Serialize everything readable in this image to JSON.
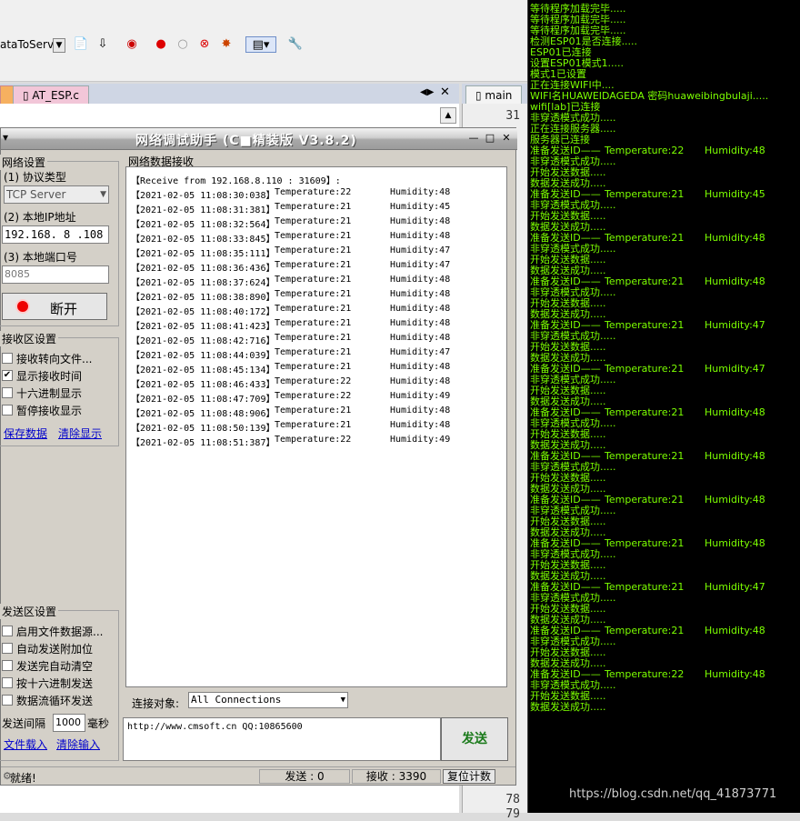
{
  "ide": {
    "toolbar_label": "ataToServer",
    "tabs": [
      {
        "label": "AT_ESP.c"
      }
    ],
    "right_tab": "main",
    "line_numbers": {
      "top": "31",
      "bottom_a": "78",
      "bottom_b": "79"
    }
  },
  "net": {
    "title": "网络调试助手 (C■精装版 V3.8.2)",
    "settings": {
      "group_title": "网络设置",
      "protocol_label": "(1) 协议类型",
      "protocol_value": "TCP Server",
      "ip_label": "(2) 本地IP地址",
      "ip_value": "192.168. 8 .108",
      "port_label": "(3) 本地端口号",
      "port_value": "8085",
      "disconnect_label": "断开"
    },
    "receive_settings": {
      "group_title": "接收区设置",
      "options": [
        {
          "label": "接收转向文件...",
          "checked": false
        },
        {
          "label": "显示接收时间",
          "checked": true
        },
        {
          "label": "十六进制显示",
          "checked": false
        },
        {
          "label": "暂停接收显示",
          "checked": false
        }
      ],
      "save_link": "保存数据",
      "clear_link": "清除显示"
    },
    "send_settings": {
      "group_title": "发送区设置",
      "options": [
        {
          "label": "启用文件数据源...",
          "checked": false
        },
        {
          "label": "自动发送附加位",
          "checked": false
        },
        {
          "label": "发送完自动清空",
          "checked": false
        },
        {
          "label": "按十六进制发送",
          "checked": false
        },
        {
          "label": "数据流循环发送",
          "checked": false
        }
      ],
      "interval_label": "发送间隔",
      "interval_value": "1000",
      "interval_unit": "毫秒",
      "file_link": "文件载入",
      "clear_input_link": "清除输入"
    },
    "data_group_title": "网络数据接收",
    "receive_header": "【Receive from 192.168.8.110 : 31609】:",
    "log": [
      {
        "time": "【2021-02-05 11:08:30:038】",
        "temp": "Temperature:22",
        "hum": "Humidity:48"
      },
      {
        "time": "【2021-02-05 11:08:31:381】",
        "temp": "Temperature:21",
        "hum": "Humidity:45"
      },
      {
        "time": "【2021-02-05 11:08:32:564】",
        "temp": "Temperature:21",
        "hum": "Humidity:48"
      },
      {
        "time": "【2021-02-05 11:08:33:845】",
        "temp": "Temperature:21",
        "hum": "Humidity:48"
      },
      {
        "time": "【2021-02-05 11:08:35:111】",
        "temp": "Temperature:21",
        "hum": "Humidity:47"
      },
      {
        "time": "【2021-02-05 11:08:36:436】",
        "temp": "Temperature:21",
        "hum": "Humidity:47"
      },
      {
        "time": "【2021-02-05 11:08:37:624】",
        "temp": "Temperature:21",
        "hum": "Humidity:48"
      },
      {
        "time": "【2021-02-05 11:08:38:890】",
        "temp": "Temperature:21",
        "hum": "Humidity:48"
      },
      {
        "time": "【2021-02-05 11:08:40:172】",
        "temp": "Temperature:21",
        "hum": "Humidity:48"
      },
      {
        "time": "【2021-02-05 11:08:41:423】",
        "temp": "Temperature:21",
        "hum": "Humidity:48"
      },
      {
        "time": "【2021-02-05 11:08:42:716】",
        "temp": "Temperature:21",
        "hum": "Humidity:48"
      },
      {
        "time": "【2021-02-05 11:08:44:039】",
        "temp": "Temperature:21",
        "hum": "Humidity:47"
      },
      {
        "time": "【2021-02-05 11:08:45:134】",
        "temp": "Temperature:21",
        "hum": "Humidity:48"
      },
      {
        "time": "【2021-02-05 11:08:46:433】",
        "temp": "Temperature:22",
        "hum": "Humidity:48"
      },
      {
        "time": "【2021-02-05 11:08:47:709】",
        "temp": "Temperature:22",
        "hum": "Humidity:49"
      },
      {
        "time": "【2021-02-05 11:08:48:906】",
        "temp": "Temperature:21",
        "hum": "Humidity:48"
      },
      {
        "time": "【2021-02-05 11:08:50:139】",
        "temp": "Temperature:21",
        "hum": "Humidity:48"
      },
      {
        "time": "【2021-02-05 11:08:51:387】",
        "temp": "Temperature:22",
        "hum": "Humidity:49"
      }
    ],
    "connect_label": "连接对象:",
    "connect_value": "All Connections",
    "send_text": "http://www.cmsoft.cn QQ:10865600",
    "send_button": "发送",
    "status": {
      "ready": "就绪!",
      "sent": "发送 : 0",
      "received": "接收 : 3390",
      "reset": "复位计数"
    }
  },
  "terminal": {
    "init_lines": [
      "等待程序加载完毕.....",
      "等待程序加载完毕.....",
      "等待程序加载完毕.....",
      "检测ESP01是否连接.....",
      "ESP01已连接",
      "设置ESP01模式1.....",
      "模式1已设置",
      "正在连接WIFI中....",
      "WIFI名HUAWEIDAGEDA 密码huaweibingbulaji.....",
      "wifi[lab]已连接",
      "非穿透模式成功.....",
      "正在连接服务器.....",
      "服务器已连接"
    ],
    "cycle_lines": [
      "准备发送ID——",
      "非穿透模式成功.....",
      "开始发送数据.....",
      "数据发送成功....."
    ],
    "readings": [
      {
        "temp": "Temperature:22",
        "hum": "Humidity:48"
      },
      {
        "temp": "Temperature:21",
        "hum": "Humidity:45"
      },
      {
        "temp": "Temperature:21",
        "hum": "Humidity:48"
      },
      {
        "temp": "Temperature:21",
        "hum": "Humidity:48"
      },
      {
        "temp": "Temperature:21",
        "hum": "Humidity:47"
      },
      {
        "temp": "Temperature:21",
        "hum": "Humidity:47"
      },
      {
        "temp": "Temperature:21",
        "hum": "Humidity:48"
      },
      {
        "temp": "Temperature:21",
        "hum": "Humidity:48"
      },
      {
        "temp": "Temperature:21",
        "hum": "Humidity:48"
      },
      {
        "temp": "Temperature:21",
        "hum": "Humidity:48"
      },
      {
        "temp": "Temperature:21",
        "hum": "Humidity:47"
      },
      {
        "temp": "Temperature:21",
        "hum": "Humidity:48"
      },
      {
        "temp": "Temperature:22",
        "hum": "Humidity:48"
      }
    ]
  },
  "watermark": "https://blog.csdn.net/qq_41873771",
  "colors": {
    "terminal_text": "#7cff00",
    "terminal_bg": "#000000",
    "send_button_text": "#1a7a1a",
    "link": "#0000cc"
  }
}
